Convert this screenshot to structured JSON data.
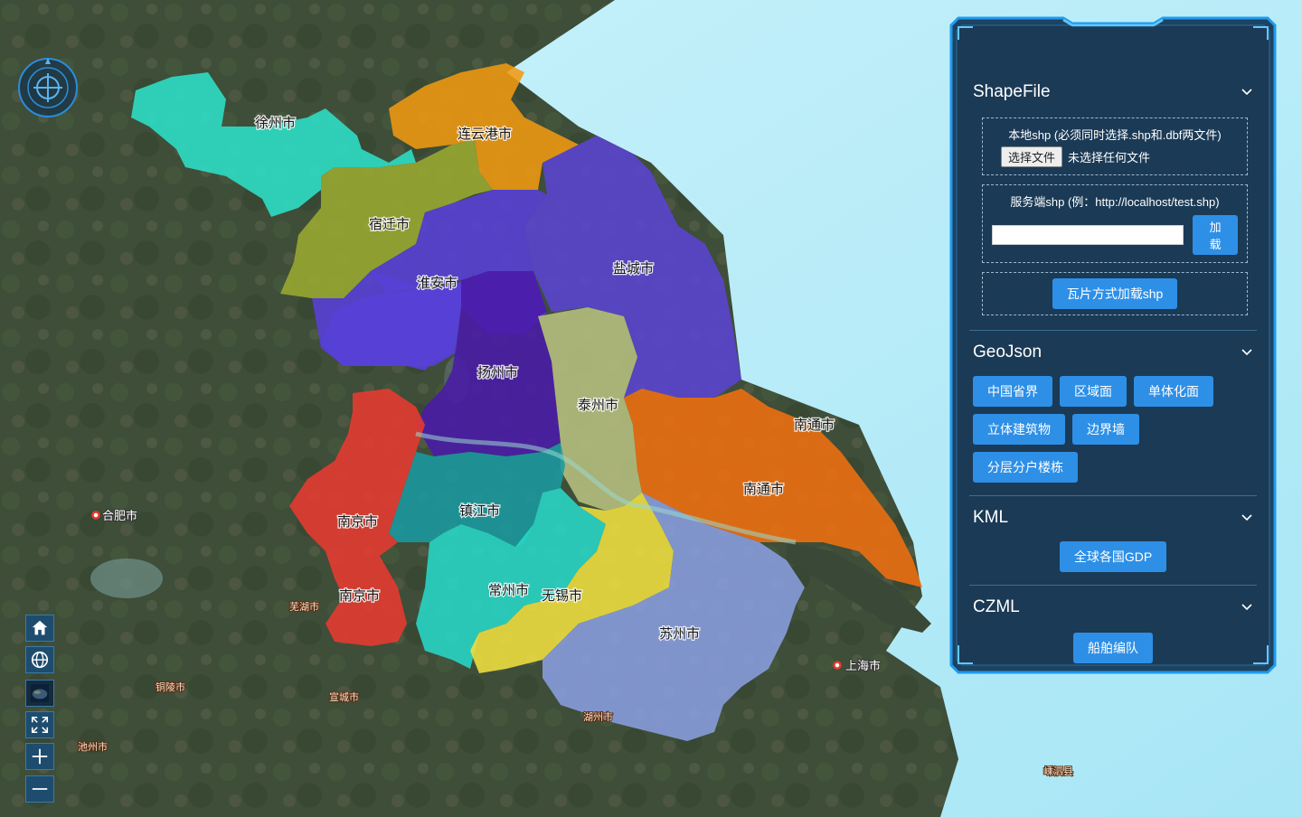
{
  "map": {
    "cities": {
      "xuzhou": "徐州市",
      "lianyungang": "连云港市",
      "suqian": "宿迁市",
      "huaian": "淮安市",
      "yancheng": "盐城市",
      "yangzhou": "扬州市",
      "taizhou": "泰州市",
      "nanjing": "南京市",
      "nanjing2": "南京市",
      "zhenjiang": "镇江市",
      "changzhou": "常州市",
      "wuxi": "无锡市",
      "suzhou": "苏州市",
      "nantong": "南通市",
      "nantong2": "南通市",
      "shanghai": "上海市",
      "hefei": "合肥市",
      "wuhu": "芜湖市",
      "chizhou": "池州市",
      "tongling": "铜陵市",
      "xuancheng": "宣城市",
      "huzhou": "湖州市",
      "shengsi": "嵊泗县"
    },
    "colors": {
      "xuzhou": "#2ee0c8",
      "lianyungang": "#f09a10",
      "suqian": "#9aaa30",
      "huaian": "#5840d8",
      "yancheng": "#5a44d2",
      "yangzhou": "#4a1aa8",
      "taizhou": "#b8c080",
      "nanjing": "#e83a30",
      "zhenjiang": "#1a9aa0",
      "changzhou": "#28d8c8",
      "wuxi": "#f0e040",
      "suzhou": "#8a9ee0",
      "nantong": "#f07010"
    }
  },
  "panel": {
    "sections": {
      "shapefile": {
        "title": "ShapeFile",
        "local_label": "本地shp (必须同时选择.shp和.dbf两文件)",
        "file_button": "选择文件",
        "file_status": "未选择任何文件",
        "server_label": "服务端shp (例：http://localhost/test.shp)",
        "url_value": "",
        "load_button": "加载",
        "tile_button": "瓦片方式加载shp"
      },
      "geojson": {
        "title": "GeoJson",
        "buttons": [
          "中国省界",
          "区域面",
          "单体化面",
          "立体建筑物",
          "边界墙",
          "分层分户楼栋"
        ]
      },
      "kml": {
        "title": "KML",
        "button": "全球各国GDP"
      },
      "czml": {
        "title": "CZML",
        "button": "船舶编队"
      }
    }
  },
  "toolbar": {
    "icons": [
      "home-icon",
      "globe-icon",
      "basemap-icon",
      "fullscreen-icon",
      "zoom-in-icon",
      "zoom-out-icon"
    ]
  },
  "theme": {
    "panel_bg": "#1b3a56",
    "panel_border": "#1e9bf0",
    "button": "#2e8fe6",
    "sea": "#d4f4fb"
  }
}
